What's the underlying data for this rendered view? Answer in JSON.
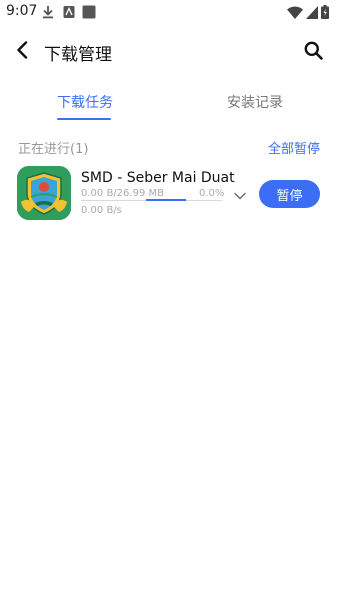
{
  "status_bar": {
    "time": "9:07",
    "left_icons": [
      "download-icon",
      "app-notification-icon",
      "square-notification-icon"
    ],
    "right_icons": [
      "wifi-icon",
      "signal-icon",
      "battery-icon"
    ]
  },
  "header": {
    "title": "下载管理",
    "back_icon": "chevron-left-icon",
    "search_icon": "search-icon"
  },
  "tabs": [
    {
      "label": "下载任务",
      "active": true
    },
    {
      "label": "安装记录",
      "active": false
    }
  ],
  "section": {
    "label": "正在进行(1)",
    "action_label": "全部暂停"
  },
  "downloads": [
    {
      "name": "SMD - Seber Mai Duat",
      "size": "0.00 B/26.99 MB",
      "percent": "0.0%",
      "speed": "0.00 B/s",
      "button_label": "暂停"
    }
  ],
  "colors": {
    "accent": "#3b6ef5",
    "muted_text": "#999999",
    "app_icon_bg": "#2f9e5d"
  }
}
